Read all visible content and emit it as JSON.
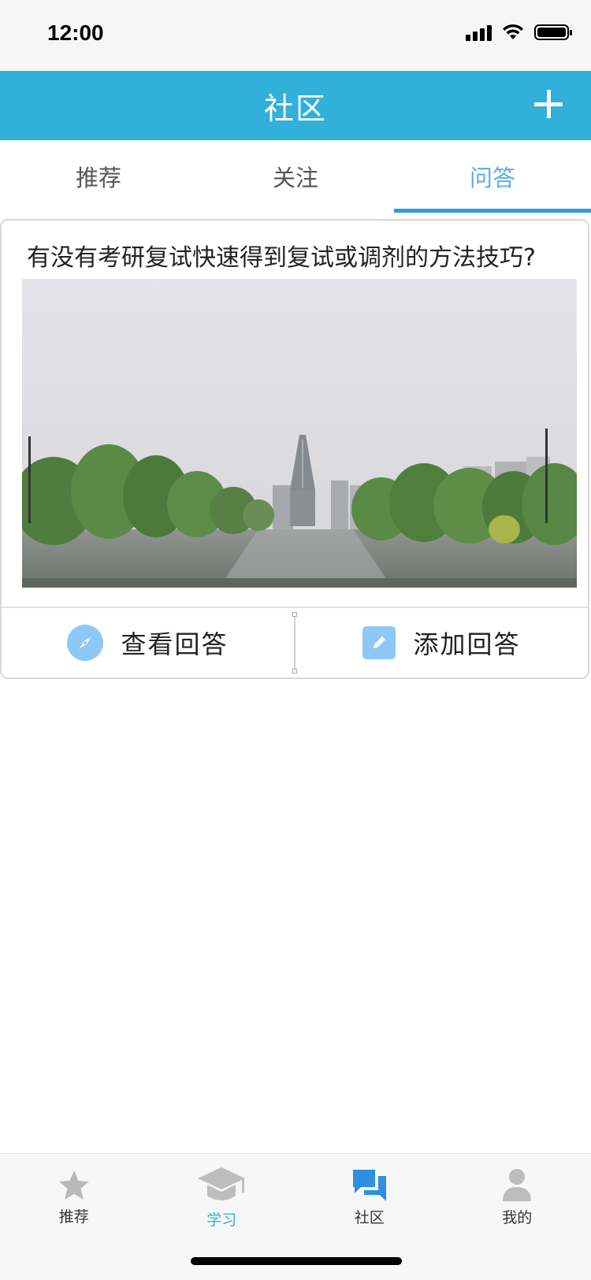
{
  "status_bar": {
    "time": "12:00"
  },
  "header": {
    "title": "社区"
  },
  "tabs": [
    {
      "label": "推荐",
      "active": false
    },
    {
      "label": "关注",
      "active": false
    },
    {
      "label": "问答",
      "active": true
    }
  ],
  "question": {
    "title": "有没有考研复试快速得到复试或调剂的方法技巧?",
    "view_answers_label": "查看回答",
    "add_answer_label": "添加回答"
  },
  "tab_bar": {
    "items": [
      {
        "label": "推荐",
        "icon": "star-icon",
        "active": false
      },
      {
        "label": "学习",
        "icon": "graduation-cap-icon",
        "active": true
      },
      {
        "label": "社区",
        "icon": "chat-icon",
        "active": false
      },
      {
        "label": "我的",
        "icon": "person-icon",
        "active": false
      }
    ]
  },
  "colors": {
    "header_bg": "#31b0da",
    "active_tab": "#5aaee8",
    "tab_underline": "#3597e2",
    "action_icon_bg": "#8ec8f7",
    "tab_bar_active": "#31b0da"
  }
}
